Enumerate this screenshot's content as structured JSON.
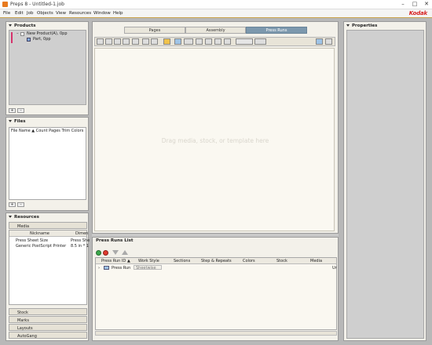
{
  "window": {
    "title": "Preps 8 - Untitled-1.job",
    "minimize": "–",
    "maximize": "□",
    "close": "✕"
  },
  "menu": [
    "File",
    "Edit",
    "Job",
    "Objects",
    "View",
    "Resources",
    "Window",
    "Help"
  ],
  "brand": {
    "name": "Kodak",
    "color": "#d61f1f"
  },
  "products": {
    "title": "Products",
    "items": [
      {
        "label": "New Product(A), 0pp"
      },
      {
        "label": "Part, 0pp"
      }
    ],
    "add": "+",
    "remove": "–"
  },
  "files": {
    "title": "Files",
    "columns": "File Name  ▲  Count Pages Trim Colors",
    "add": "+",
    "remove": "–"
  },
  "resources": {
    "title": "Resources",
    "media_tab": "Media",
    "col_nickname": "Nickname",
    "col_dimen": "Dimen",
    "rows": [
      {
        "nickname": "Press Sheet Size",
        "dimen": "Press She"
      },
      {
        "nickname": "Generic PostScript Printer",
        "dimen": "8.5 in * 1"
      }
    ],
    "bottom_tabs": [
      "Stock",
      "Marks",
      "Layouts",
      "AutoGang"
    ]
  },
  "center_tabs": [
    {
      "label": "Pages",
      "active": false
    },
    {
      "label": "Assembly",
      "active": false
    },
    {
      "label": "Press Runs",
      "active": true
    }
  ],
  "canvas": {
    "hint": "Drag media, stock, or template here"
  },
  "press_runs": {
    "title": "Press Runs List",
    "columns": [
      "Press Run ID",
      "Work Style",
      "Sections",
      "Step & Repeats",
      "Colors",
      "Stock",
      "Media"
    ],
    "sort_indicator": "▲",
    "row": {
      "id": "Press Run",
      "work_style": "Sheetwise",
      "tail": "Ur"
    }
  },
  "properties": {
    "title": "Properties"
  },
  "icons": [
    "close-icon",
    "minimize-icon",
    "maximize-icon",
    "add-icon",
    "remove-icon",
    "disclosure-triangle-icon"
  ]
}
